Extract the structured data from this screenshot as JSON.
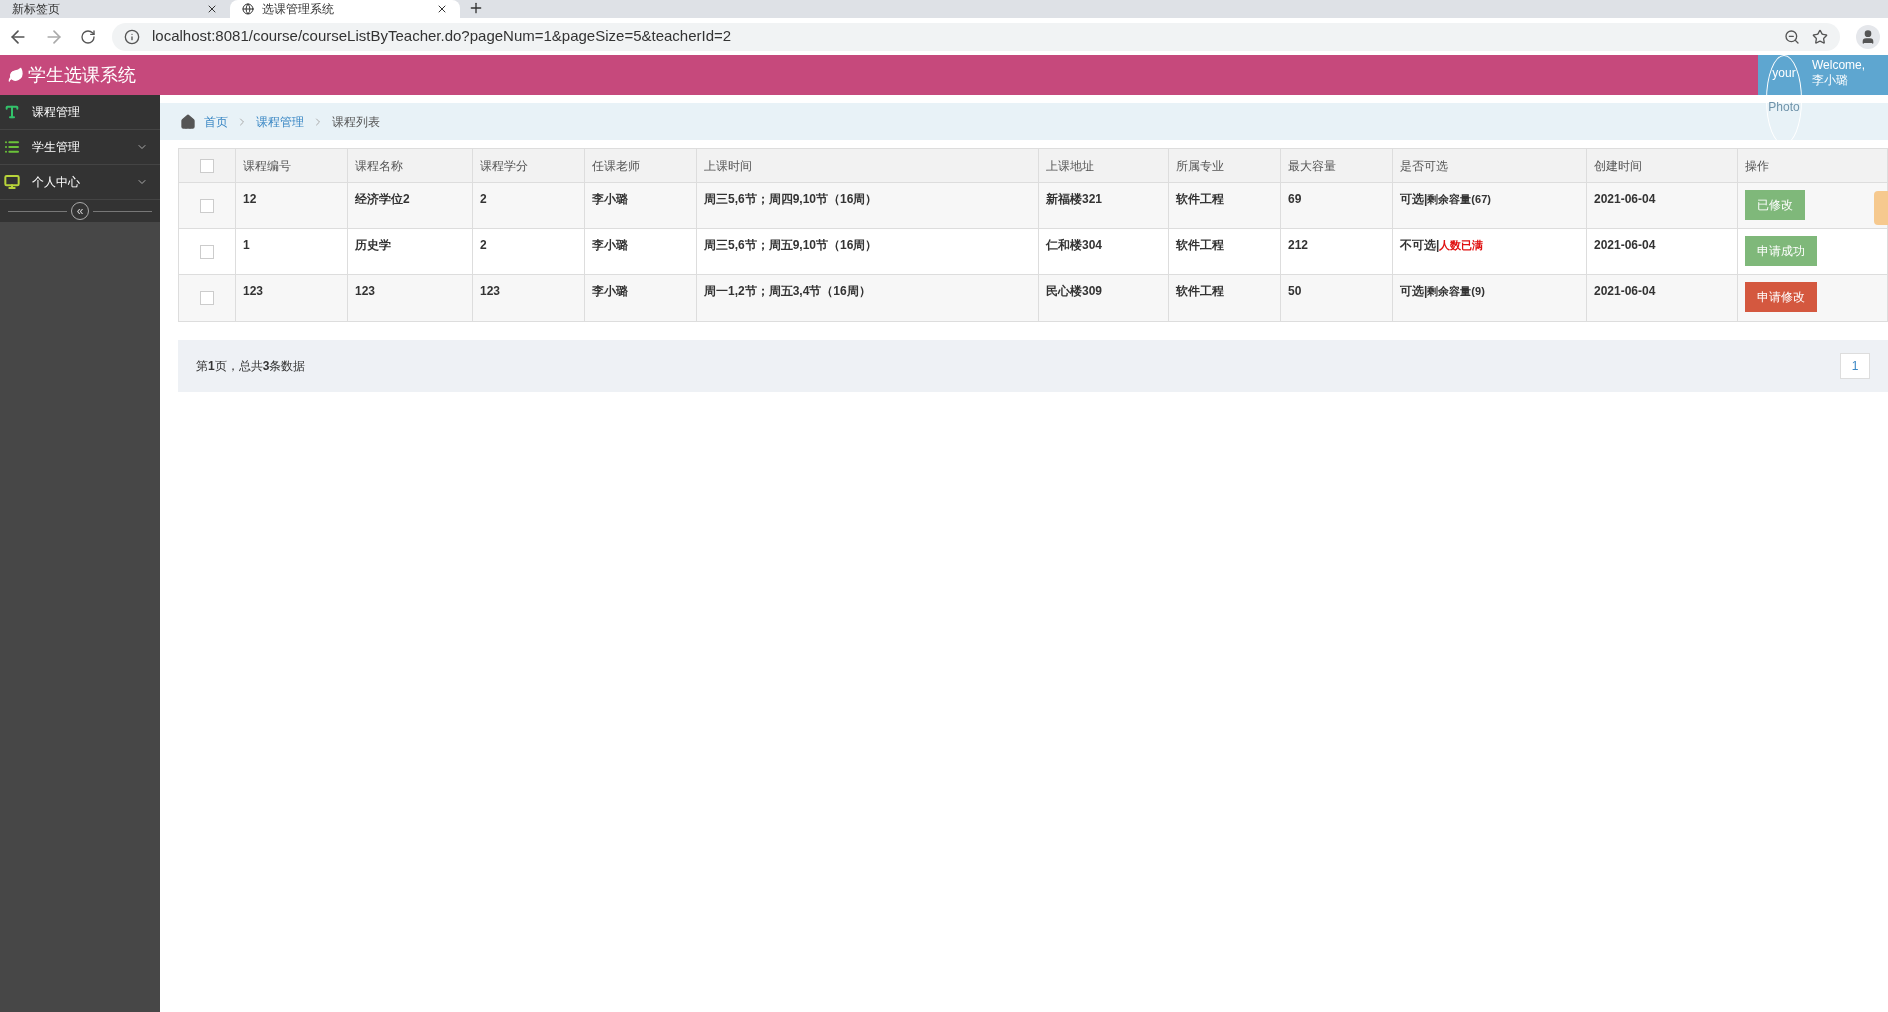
{
  "browser": {
    "tabs": [
      {
        "title": "新标签页",
        "selected": false
      },
      {
        "title": "选课管理系统",
        "selected": true
      }
    ],
    "url": "localhost:8081/course/courseListByTeacher.do?pageNum=1&pageSize=5&teacherId=2"
  },
  "header": {
    "title": "学生选课系统",
    "welcome": "Welcome,",
    "user": "李小璐",
    "avatar_alt": [
      "your",
      "Photo"
    ]
  },
  "sidebar": {
    "items": [
      {
        "label": "课程管理",
        "kind": "text",
        "expandable": false
      },
      {
        "label": "学生管理",
        "kind": "list",
        "expandable": true
      },
      {
        "label": "个人中心",
        "kind": "monitor",
        "expandable": true
      }
    ],
    "collapse": "«"
  },
  "breadcrumb": [
    {
      "label": "首页",
      "link": true
    },
    {
      "label": "课程管理",
      "link": true
    },
    {
      "label": "课程列表",
      "link": false
    }
  ],
  "table": {
    "all_checked": false,
    "columns": [
      "课程编号",
      "课程名称",
      "课程学分",
      "任课老师",
      "上课时间",
      "上课地址",
      "所属专业",
      "最大容量",
      "是否可选",
      "创建时间",
      "操作"
    ],
    "rows": [
      {
        "checked": false,
        "cells": [
          "12",
          "经济学位2",
          "2",
          "李小璐",
          "周三5,6节；周四9,10节（16周）",
          "新福楼321",
          "软件工程",
          "69"
        ],
        "status": "可选|",
        "detail": "剩余容量(67)",
        "full": false,
        "created": "2021-06-04",
        "action": {
          "label": "已修改",
          "kind": "done"
        }
      },
      {
        "checked": false,
        "cells": [
          "1",
          "历史学",
          "2",
          "李小璐",
          "周三5,6节；周五9,10节（16周）",
          "仁和楼304",
          "软件工程",
          "212"
        ],
        "status": "不可选|",
        "detail": "人数已满",
        "full": true,
        "created": "2021-06-04",
        "action": {
          "label": "申请成功",
          "kind": "done"
        }
      },
      {
        "checked": false,
        "cells": [
          "123",
          "123",
          "123",
          "李小璐",
          "周一1,2节；周五3,4节（16周）",
          "民心楼309",
          "软件工程",
          "50"
        ],
        "status": "可选|",
        "detail": "剩余容量(9)",
        "full": false,
        "created": "2021-06-04",
        "action": {
          "label": "申请修改",
          "kind": "request"
        }
      }
    ]
  },
  "pagination": {
    "summary": "第**1**页，总共**3**条数据",
    "pages": [
      {
        "label": "1",
        "selected": true
      }
    ]
  }
}
